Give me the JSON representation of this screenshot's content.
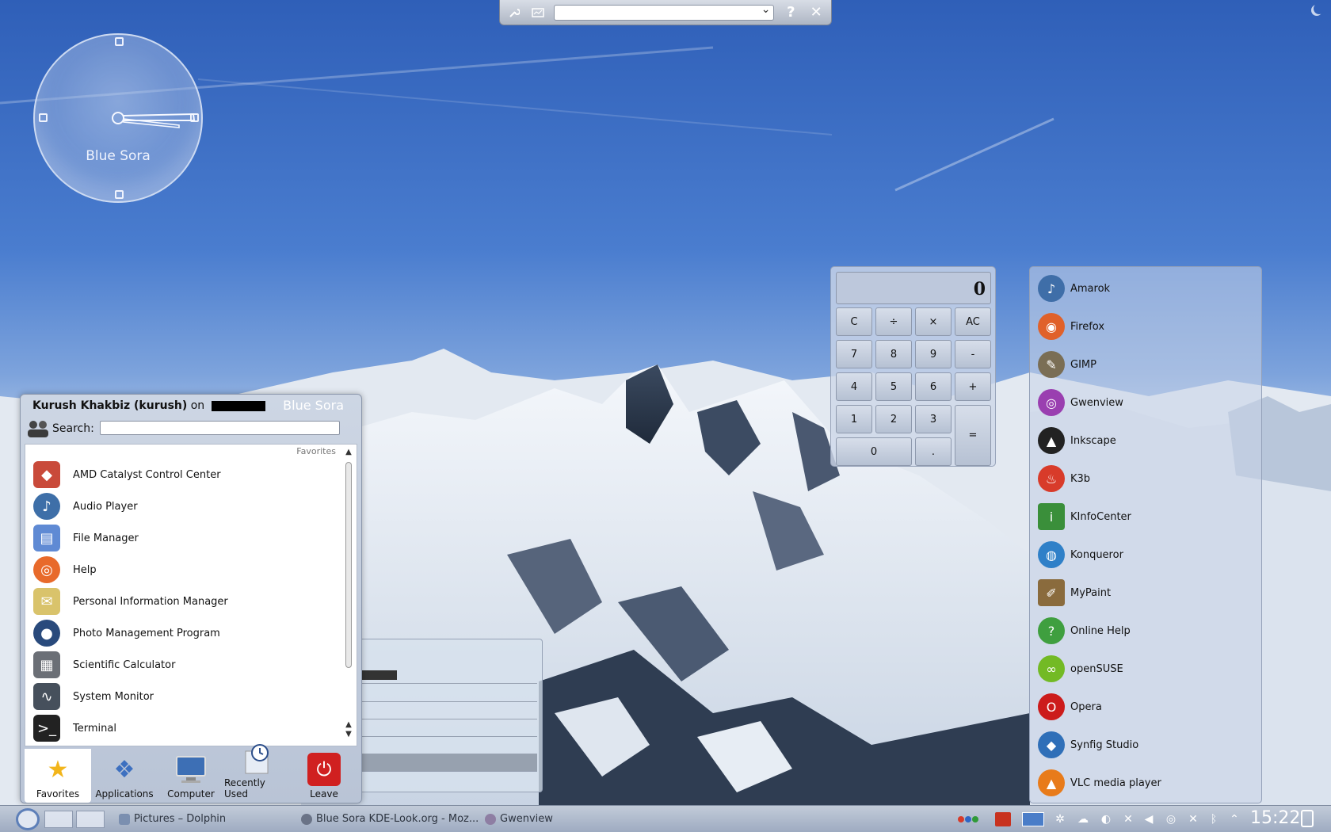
{
  "desktop": {
    "clock_label": "Blue Sora"
  },
  "top_toolbar": {
    "wrench_icon": "wrench-icon",
    "activity_icon": "activity-icon",
    "combo_value": "",
    "help_label": "?",
    "close_label": "✕"
  },
  "kickoff": {
    "user": "Kurush Khakbiz (kurush)",
    "on_label": "on",
    "brand": "Blue Sora",
    "search_label": "Search:",
    "search_value": "",
    "section_title": "Favorites",
    "items": [
      {
        "label": "AMD Catalyst Control Center",
        "icon": "amd-icon",
        "color": "#c94a3a"
      },
      {
        "label": "Audio Player",
        "icon": "amarok-icon",
        "color": "#3e6fa8"
      },
      {
        "label": "File Manager",
        "icon": "folder-icon",
        "color": "#5f8ad4"
      },
      {
        "label": "Help",
        "icon": "lifebuoy-icon",
        "color": "#e86a2b"
      },
      {
        "label": "Personal Information Manager",
        "icon": "kontact-icon",
        "color": "#d9c36b"
      },
      {
        "label": "Photo Management Program",
        "icon": "camera-icon",
        "color": "#294a7c"
      },
      {
        "label": "Scientific Calculator",
        "icon": "calculator-icon",
        "color": "#6b6f76"
      },
      {
        "label": "System Monitor",
        "icon": "monitor-icon",
        "color": "#46505c"
      },
      {
        "label": "Terminal",
        "icon": "terminal-icon",
        "color": "#222"
      }
    ],
    "tabs": [
      {
        "label": "Favorites",
        "icon": "star-icon"
      },
      {
        "label": "Applications",
        "icon": "applications-icon"
      },
      {
        "label": "Computer",
        "icon": "computer-icon"
      },
      {
        "label": "Recently Used",
        "icon": "clock-icon"
      },
      {
        "label": "Leave",
        "icon": "power-icon"
      }
    ]
  },
  "calculator": {
    "display": "0",
    "buttons": {
      "c": "C",
      "div": "÷",
      "mul": "×",
      "ac": "AC",
      "n7": "7",
      "n8": "8",
      "n9": "9",
      "minus": "-",
      "n4": "4",
      "n5": "5",
      "n6": "6",
      "plus": "+",
      "n1": "1",
      "n2": "2",
      "n3": "3",
      "eq": "=",
      "n0": "0",
      "dot": "."
    }
  },
  "quicklaunch": [
    {
      "label": "Amarok",
      "icon": "amarok-icon",
      "color": "#3f6ea8"
    },
    {
      "label": "Firefox",
      "icon": "firefox-icon",
      "color": "#e0612a"
    },
    {
      "label": "GIMP",
      "icon": "gimp-icon",
      "color": "#7a6e55"
    },
    {
      "label": "Gwenview",
      "icon": "gwenview-icon",
      "color": "#9a3fb0"
    },
    {
      "label": "Inkscape",
      "icon": "inkscape-icon",
      "color": "#222"
    },
    {
      "label": "K3b",
      "icon": "k3b-icon",
      "color": "#d83b2a"
    },
    {
      "label": "KInfoCenter",
      "icon": "kinfocenter-icon",
      "color": "#3a8f3a"
    },
    {
      "label": "Konqueror",
      "icon": "konqueror-icon",
      "color": "#2f80c8"
    },
    {
      "label": "MyPaint",
      "icon": "mypaint-icon",
      "color": "#8a6b3d"
    },
    {
      "label": "Online Help",
      "icon": "online-help-icon",
      "color": "#3f9f3f"
    },
    {
      "label": "openSUSE",
      "icon": "opensuse-icon",
      "color": "#73ba25"
    },
    {
      "label": "Opera",
      "icon": "opera-icon",
      "color": "#cc1b1b"
    },
    {
      "label": "Synfig Studio",
      "icon": "synfig-icon",
      "color": "#2f6fb8"
    },
    {
      "label": "VLC media player",
      "icon": "vlc-icon",
      "color": "#e87b1a"
    }
  ],
  "taskbar": {
    "tasks": [
      {
        "label": "Pictures – Dolphin",
        "icon": "dolphin-icon"
      },
      {
        "label": "Blue Sora KDE-Look.org - Moz...",
        "icon": "firefox-icon"
      },
      {
        "label": "Gwenview",
        "icon": "gwenview-icon"
      }
    ],
    "time": "15:22"
  }
}
